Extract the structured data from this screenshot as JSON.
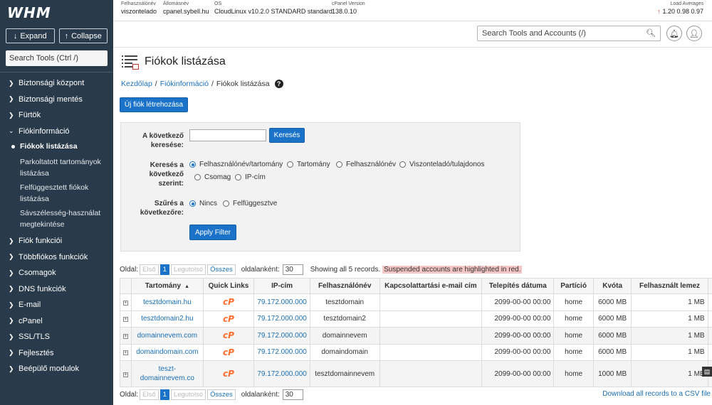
{
  "app": {
    "logo": "WHM"
  },
  "sidebar": {
    "expand_label": "Expand",
    "collapse_label": "Collapse",
    "search_placeholder": "Search Tools (Ctrl /)",
    "items_top": [
      "Biztonsági központ",
      "Biztonsági mentés",
      "Fürtök",
      "Fiókinformáció"
    ],
    "active_sub": "Fiókok listázása",
    "subs": [
      "Parkoltatott tartományok listázása",
      "Felfüggesztett fiókok listázása",
      "Sávszélesség-használat megtekintése"
    ],
    "items_bottom": [
      "Fiók funkciói",
      "Többfiókos funkciók",
      "Csomagok",
      "DNS funkciók",
      "E-mail",
      "cPanel",
      "SSL/TLS",
      "Fejlesztés",
      "Beépülő modulok"
    ]
  },
  "topbar": {
    "user_label": "Felhasználónév",
    "user_value": "viszontelado",
    "host_label": "Állomásnév",
    "host_value": "cpanel.sybell.hu",
    "os_label": "OS",
    "os_value": "CloudLinux v10.2.0 STANDARD standard",
    "ver_label": "cPanel Version",
    "ver_value": "138.0.10",
    "load_label": "Load Averages",
    "load_value": "1.20  0.98  0.97"
  },
  "search": {
    "placeholder": "Search Tools and Accounts (/)"
  },
  "page": {
    "title": "Fiókok listázása",
    "crumb1": "Kezdőlap",
    "crumb2": "Fiókinformáció",
    "crumb3": "Fiókok listázása",
    "new_account": "Új fiók létrehozása"
  },
  "filter": {
    "search_label": "A következő keresése:",
    "search_button": "Keresés",
    "by_label": "Keresés a következő szerint:",
    "by_options": [
      "Felhasználónév/tartomány",
      "Tartomány",
      "Felhasználónév",
      "Viszonteladó/tulajdonos",
      "Csomag",
      "IP-cím"
    ],
    "filter_label": "Szűrés a következőre:",
    "filter_options": [
      "Nincs",
      "Felfüggesztve"
    ],
    "apply": "Apply Filter"
  },
  "pager": {
    "page_label": "Oldal:",
    "first": "Első",
    "current": "1",
    "last": "Legutolsó",
    "all": "Összes",
    "per_page_label": "oldalanként:",
    "per_page_value": "30",
    "showing": "Showing all 5 records.",
    "suspended_note": "Suspended accounts are highlighted in red.",
    "csv": "Download all records to a CSV file"
  },
  "table": {
    "headers": [
      "Tartomány",
      "Quick Links",
      "IP-cím",
      "Felhasználónév",
      "Kapcsolattartási e-mail cím",
      "Telepítés dátuma",
      "Partíció",
      "Kvóta",
      "Felhasznált lemez"
    ],
    "rows": [
      {
        "domain": "tesztdomain.hu",
        "ip": "79.172.000.000",
        "user": "tesztdomain",
        "email": "",
        "date": "2099-00-00 00:00",
        "partition": "home",
        "quota": "6000 MB",
        "used": "1 MB"
      },
      {
        "domain": "tesztdomain2.hu",
        "ip": "79.172.000.000",
        "user": "tesztdomain2",
        "email": "",
        "date": "2099-00-00 00:00",
        "partition": "home",
        "quota": "6000 MB",
        "used": "1 MB"
      },
      {
        "domain": "domainnevem.com",
        "ip": "79.172.000.000",
        "user": "domainnevem",
        "email": "",
        "date": "2099-00-00 00:00",
        "partition": "home",
        "quota": "6000 MB",
        "used": "1 MB"
      },
      {
        "domain": "domaindomain.com",
        "ip": "79.172.000.000",
        "user": "domaindomain",
        "email": "",
        "date": "2099-00-00 00:00",
        "partition": "home",
        "quota": "6000 MB",
        "used": "1 MB"
      },
      {
        "domain": "teszt-domainnevem.co",
        "ip": "79.172.000.000",
        "user": "tesztdomainnevem",
        "email": "",
        "date": "2099-00-00 00:00",
        "partition": "home",
        "quota": "1000 MB",
        "used": "1 MB"
      }
    ]
  }
}
